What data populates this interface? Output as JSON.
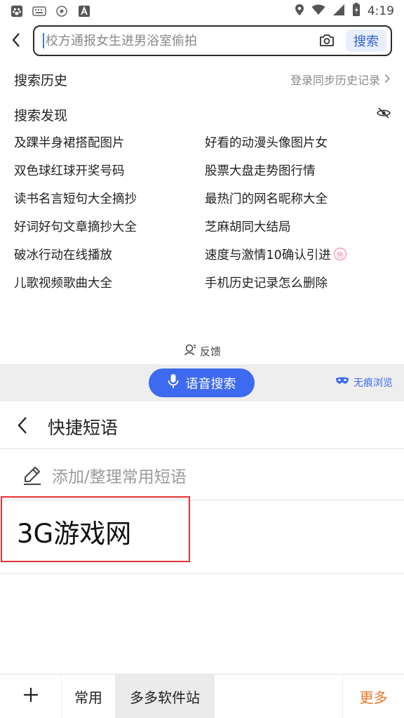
{
  "status_bar": {
    "time": "4:19",
    "icons": [
      "paw-icon",
      "keyboard-icon",
      "target-icon",
      "a-box-icon"
    ],
    "right_icons": [
      "location-icon",
      "wifi-icon",
      "signal-icon",
      "battery-icon"
    ]
  },
  "search": {
    "placeholder": "校方通报女生进男浴室偷拍",
    "button_label": "搜索",
    "accent": "#3d6af0"
  },
  "history": {
    "title": "搜索历史",
    "sync_label": "登录同步历史记录"
  },
  "discover": {
    "title": "搜索发现",
    "items": [
      {
        "label": "及踝半身裙搭配图片"
      },
      {
        "label": "好看的动漫头像图片女"
      },
      {
        "label": "双色球红球开奖号码"
      },
      {
        "label": "股票大盘走势图行情"
      },
      {
        "label": "读书名言短句大全摘抄"
      },
      {
        "label": "最热门的网名昵称大全"
      },
      {
        "label": "好词好句文章摘抄大全"
      },
      {
        "label": "芝麻胡同大结局"
      },
      {
        "label": "破冰行动在线播放"
      },
      {
        "label": "速度与激情10确认引进",
        "badge": "热"
      },
      {
        "label": "儿歌视频歌曲大全"
      },
      {
        "label": "手机历史记录怎么删除"
      }
    ]
  },
  "feedback_label": "反馈",
  "voice": {
    "button_label": "语音搜索",
    "incognito_label": "无痕浏览"
  },
  "phrases": {
    "title": "快捷短语",
    "add_label": "添加/整理常用短语",
    "items": [
      "3G游戏网"
    ],
    "highlight_color": "#e53232"
  },
  "bottom_bar": {
    "tabs": [
      "常用",
      "多多软件站"
    ],
    "more_label": "更多",
    "more_color": "#e8752a"
  }
}
